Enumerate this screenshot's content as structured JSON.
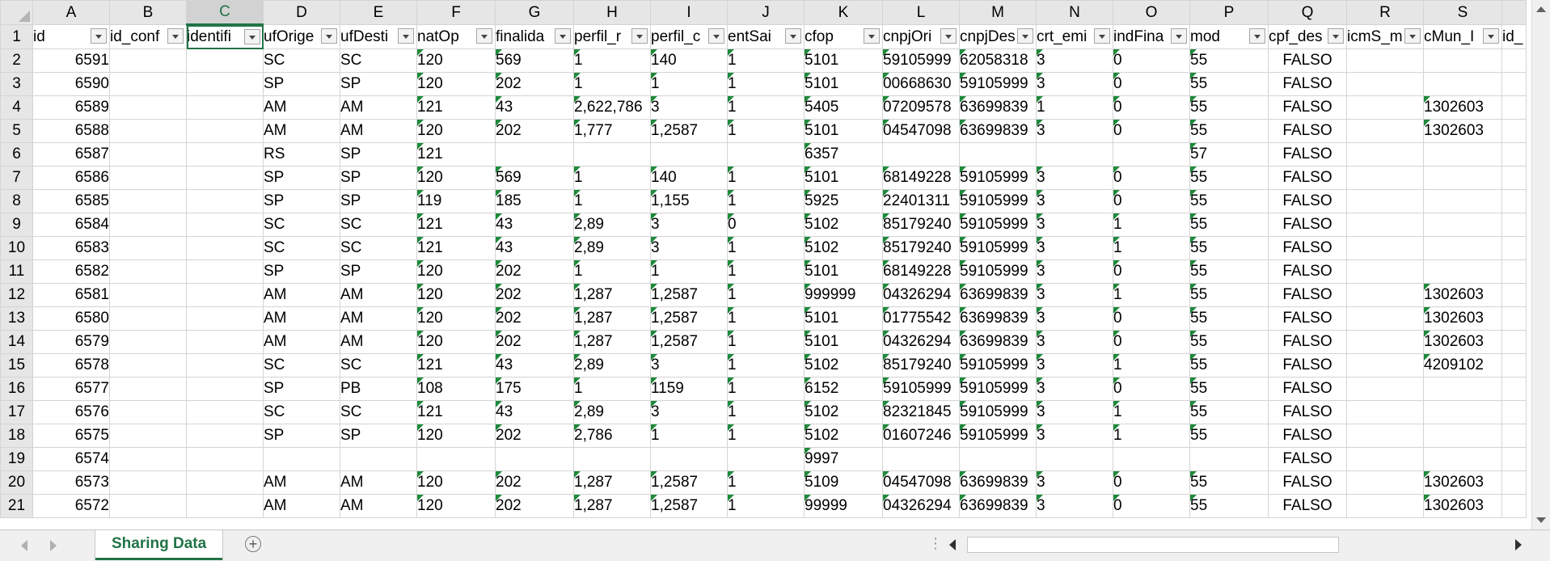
{
  "sheet": {
    "columns": [
      "A",
      "B",
      "C",
      "D",
      "E",
      "F",
      "G",
      "H",
      "I",
      "J",
      "K",
      "L",
      "M",
      "N",
      "O",
      "P",
      "Q",
      "R",
      "S",
      ""
    ],
    "selected_column": "C",
    "headers": [
      "id",
      "id_conf",
      "identifi",
      "ufOrige",
      "ufDesti",
      "natOp",
      "finalida",
      "perfil_r",
      "perfil_c",
      "entSai",
      "cfop",
      "cnpjOri",
      "cnpjDes",
      "crt_emi",
      "indFina",
      "mod",
      "cpf_des",
      "icmS_m",
      "cMun_I",
      "id_"
    ],
    "rows": [
      {
        "n": "2",
        "cells": [
          "6591",
          "",
          "",
          "SC",
          "SC",
          "120",
          "569",
          "1",
          "140",
          "1",
          "5101",
          "59105999",
          "62058318",
          "3",
          "0",
          "55",
          "FALSO",
          "",
          ""
        ]
      },
      {
        "n": "3",
        "cells": [
          "6590",
          "",
          "",
          "SP",
          "SP",
          "120",
          "202",
          "1",
          "1",
          "1",
          "5101",
          "00668630",
          "59105999",
          "3",
          "0",
          "55",
          "FALSO",
          "",
          ""
        ]
      },
      {
        "n": "4",
        "cells": [
          "6589",
          "",
          "",
          "AM",
          "AM",
          "121",
          "43",
          "2,622,786",
          "3",
          "1",
          "5405",
          "07209578",
          "63699839",
          "1",
          "0",
          "55",
          "FALSO",
          "",
          "1302603"
        ]
      },
      {
        "n": "5",
        "cells": [
          "6588",
          "",
          "",
          "AM",
          "AM",
          "120",
          "202",
          "1,777",
          "1,2587",
          "1",
          "5101",
          "04547098",
          "63699839",
          "3",
          "0",
          "55",
          "FALSO",
          "",
          "1302603"
        ]
      },
      {
        "n": "6",
        "cells": [
          "6587",
          "",
          "",
          "RS",
          "SP",
          "121",
          "",
          "",
          "",
          "",
          "6357",
          "",
          "",
          "",
          "",
          "57",
          "FALSO",
          "",
          ""
        ]
      },
      {
        "n": "7",
        "cells": [
          "6586",
          "",
          "",
          "SP",
          "SP",
          "120",
          "569",
          "1",
          "140",
          "1",
          "5101",
          "68149228",
          "59105999",
          "3",
          "0",
          "55",
          "FALSO",
          "",
          ""
        ]
      },
      {
        "n": "8",
        "cells": [
          "6585",
          "",
          "",
          "SP",
          "SP",
          "119",
          "185",
          "1",
          "1,155",
          "1",
          "5925",
          "22401311",
          "59105999",
          "3",
          "0",
          "55",
          "FALSO",
          "",
          ""
        ]
      },
      {
        "n": "9",
        "cells": [
          "6584",
          "",
          "",
          "SC",
          "SC",
          "121",
          "43",
          "2,89",
          "3",
          "0",
          "5102",
          "85179240",
          "59105999",
          "3",
          "1",
          "55",
          "FALSO",
          "",
          ""
        ]
      },
      {
        "n": "10",
        "cells": [
          "6583",
          "",
          "",
          "SC",
          "SC",
          "121",
          "43",
          "2,89",
          "3",
          "1",
          "5102",
          "85179240",
          "59105999",
          "3",
          "1",
          "55",
          "FALSO",
          "",
          ""
        ]
      },
      {
        "n": "11",
        "cells": [
          "6582",
          "",
          "",
          "SP",
          "SP",
          "120",
          "202",
          "1",
          "1",
          "1",
          "5101",
          "68149228",
          "59105999",
          "3",
          "0",
          "55",
          "FALSO",
          "",
          ""
        ]
      },
      {
        "n": "12",
        "cells": [
          "6581",
          "",
          "",
          "AM",
          "AM",
          "120",
          "202",
          "1,287",
          "1,2587",
          "1",
          "999999",
          "04326294",
          "63699839",
          "3",
          "1",
          "55",
          "FALSO",
          "",
          "1302603"
        ]
      },
      {
        "n": "13",
        "cells": [
          "6580",
          "",
          "",
          "AM",
          "AM",
          "120",
          "202",
          "1,287",
          "1,2587",
          "1",
          "5101",
          "01775542",
          "63699839",
          "3",
          "0",
          "55",
          "FALSO",
          "",
          "1302603"
        ]
      },
      {
        "n": "14",
        "cells": [
          "6579",
          "",
          "",
          "AM",
          "AM",
          "120",
          "202",
          "1,287",
          "1,2587",
          "1",
          "5101",
          "04326294",
          "63699839",
          "3",
          "0",
          "55",
          "FALSO",
          "",
          "1302603"
        ]
      },
      {
        "n": "15",
        "cells": [
          "6578",
          "",
          "",
          "SC",
          "SC",
          "121",
          "43",
          "2,89",
          "3",
          "1",
          "5102",
          "85179240",
          "59105999",
          "3",
          "1",
          "55",
          "FALSO",
          "",
          "4209102"
        ]
      },
      {
        "n": "16",
        "cells": [
          "6577",
          "",
          "",
          "SP",
          "PB",
          "108",
          "175",
          "1",
          "1159",
          "1",
          "6152",
          "59105999",
          "59105999",
          "3",
          "0",
          "55",
          "FALSO",
          "",
          ""
        ]
      },
      {
        "n": "17",
        "cells": [
          "6576",
          "",
          "",
          "SC",
          "SC",
          "121",
          "43",
          "2,89",
          "3",
          "1",
          "5102",
          "82321845",
          "59105999",
          "3",
          "1",
          "55",
          "FALSO",
          "",
          ""
        ]
      },
      {
        "n": "18",
        "cells": [
          "6575",
          "",
          "",
          "SP",
          "SP",
          "120",
          "202",
          "2,786",
          "1",
          "1",
          "5102",
          "01607246",
          "59105999",
          "3",
          "1",
          "55",
          "FALSO",
          "",
          ""
        ]
      },
      {
        "n": "19",
        "cells": [
          "6574",
          "",
          "",
          "",
          "",
          "",
          "",
          "",
          "",
          "",
          "9997",
          "",
          "",
          "",
          "",
          "",
          "FALSO",
          "",
          ""
        ]
      },
      {
        "n": "20",
        "cells": [
          "6573",
          "",
          "",
          "AM",
          "AM",
          "120",
          "202",
          "1,287",
          "1,2587",
          "1",
          "5109",
          "04547098",
          "63699839",
          "3",
          "0",
          "55",
          "FALSO",
          "",
          "1302603"
        ]
      },
      {
        "n": "21",
        "cells": [
          "6572",
          "",
          "",
          "AM",
          "AM",
          "120",
          "202",
          "1,287",
          "1,2587",
          "1",
          "99999",
          "04326294",
          "63699839",
          "3",
          "0",
          "55",
          "FALSO",
          "",
          "1302603"
        ]
      }
    ]
  },
  "sheet_tab": {
    "label": "Sharing Data"
  },
  "add_sheet": {
    "label": "+"
  },
  "colors": {
    "accent": "#217346",
    "flag": "#1d8a3a"
  }
}
